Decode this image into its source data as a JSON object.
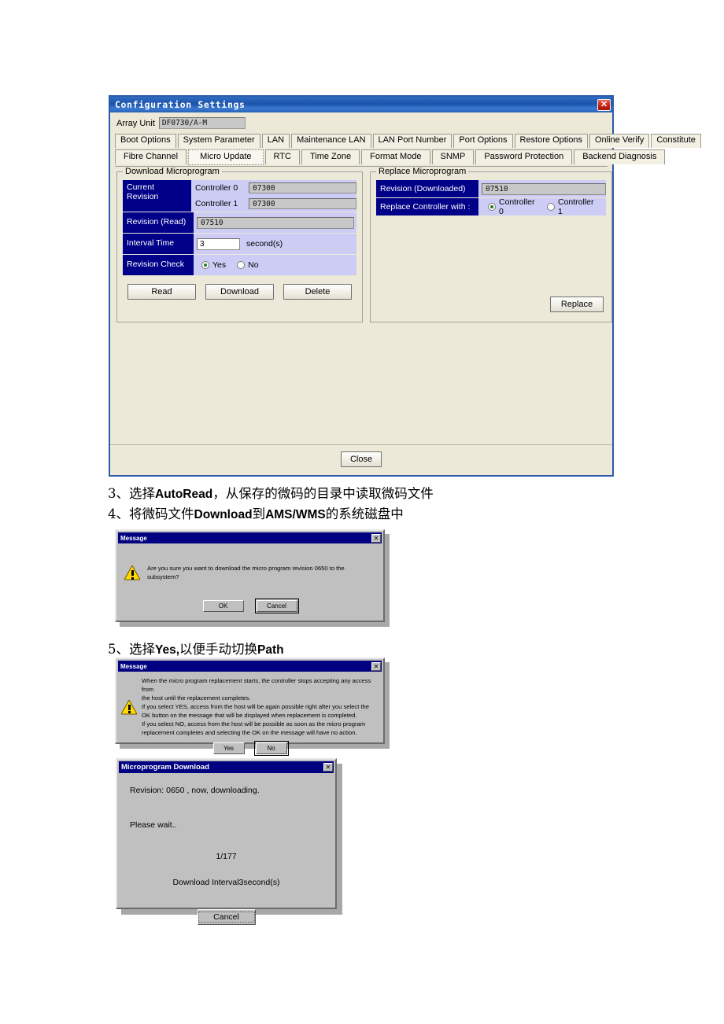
{
  "config_window": {
    "title": "Configuration Settings",
    "close_icon": "✕",
    "array_unit": {
      "label": "Array Unit",
      "value": "DF0730/A-M"
    },
    "tabs_row1": [
      "Boot Options",
      "System Parameter",
      "LAN",
      "Maintenance LAN",
      "LAN Port Number",
      "Port Options",
      "Restore Options",
      "Online Verify",
      "Constitute"
    ],
    "tabs_row2": [
      "Fibre Channel",
      "Micro Update",
      "RTC",
      "Time Zone",
      "Format Mode",
      "SNMP",
      "Password Protection",
      "Backend Diagnosis"
    ],
    "selected_tab": "Micro Update",
    "download_group": {
      "legend": "Download Microprogram",
      "current_revision_label": "Current Revision",
      "controller0_label": "Controller 0",
      "controller0_value": "07300",
      "controller1_label": "Controller 1",
      "controller1_value": "07300",
      "revision_read_label": "Revision (Read)",
      "revision_read_value": "07510",
      "interval_time_label": "Interval Time",
      "interval_time_value": "3",
      "interval_time_unit": "second(s)",
      "revision_check_label": "Revision Check",
      "revision_check_yes": "Yes",
      "revision_check_no": "No",
      "revision_check_selected": "Yes",
      "buttons": [
        "Read",
        "Download",
        "Delete"
      ]
    },
    "replace_group": {
      "legend": "Replace Microprogram",
      "revision_downloaded_label": "Revision (Downloaded)",
      "revision_downloaded_value": "07510",
      "replace_controller_label": "Replace Controller with :",
      "controller0_label": "Controller 0",
      "controller1_label": "Controller 1",
      "selected_controller": "Controller 0",
      "replace_button": "Replace"
    },
    "close_button": "Close"
  },
  "body_text": {
    "line3_prefix": "3、选择",
    "line3_en": "AutoRead",
    "line3_suffix": "，从保存的微码的目录中读取微码文件",
    "line4_prefix": "4、将微码文件",
    "line4_en": "Download",
    "line4_mid": "到",
    "line4_en2": "AMS/WMS",
    "line4_suffix": "的系统磁盘中",
    "line5_prefix": "5、选择",
    "line5_en": "Yes,",
    "line5_suffix": "以便手动切换",
    "line5_en2": "Path"
  },
  "dialog_download_confirm": {
    "title": "Message",
    "close_icon": "✕",
    "message": "Are you sure you want to download the micro program revision  0650   to the subsystem?",
    "ok_button": "OK",
    "cancel_button": "Cancel"
  },
  "dialog_replace_warning": {
    "title": "Message",
    "close_icon": "✕",
    "line1": "When the micro program replacement starts, the controller stops accepting any access from",
    "line2": "the host until the replacement completes.",
    "line3": "If you select YES, access from the host will be again possible right after you select the",
    "line4": "OK button on the message that will be displayed when replacement is completed.",
    "line5": "If you select NO, access from the host will be possible as soon as the micro program",
    "line6": "replacement completes and selecting the OK on the message will have no action.",
    "yes_button": "Yes",
    "no_button": "No"
  },
  "dialog_progress": {
    "title": "Microprogram Download",
    "close_icon": "✕",
    "revision_line": "Revision: 0650  , now, downloading.",
    "please_wait": "Please wait..",
    "counter": "1/177",
    "interval_line": "Download Interval3second(s)",
    "cancel_button": "Cancel"
  }
}
